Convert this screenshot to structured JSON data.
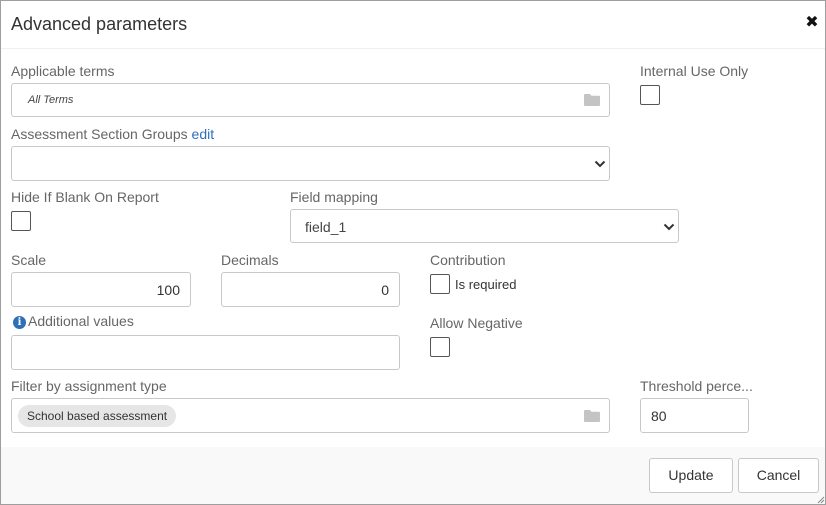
{
  "dialog": {
    "title": "Advanced parameters",
    "close_icon": "close-icon"
  },
  "applicable_terms": {
    "label": "Applicable terms",
    "value": "All Terms",
    "icon": "folder-icon"
  },
  "internal_use_only": {
    "label": "Internal Use Only",
    "checked": false
  },
  "assessment_section_groups": {
    "label": "Assessment Section Groups",
    "edit_label": "edit",
    "value": ""
  },
  "hide_if_blank": {
    "label": "Hide If Blank On Report",
    "checked": false
  },
  "field_mapping": {
    "label": "Field mapping",
    "value": "field_1"
  },
  "scale": {
    "label": "Scale",
    "value": "100"
  },
  "decimals": {
    "label": "Decimals",
    "value": "0"
  },
  "contribution": {
    "label": "Contribution",
    "checkbox_label": "Is required",
    "checked": false
  },
  "additional_values": {
    "label": "Additional values",
    "value": "",
    "icon": "info-icon"
  },
  "allow_negative": {
    "label": "Allow Negative",
    "checked": false
  },
  "filter_by_assignment_type": {
    "label": "Filter by assignment type",
    "chip": "School based assessment",
    "icon": "folder-icon"
  },
  "threshold": {
    "label": "Threshold perce...",
    "value": "80"
  },
  "footer": {
    "update_label": "Update",
    "cancel_label": "Cancel"
  },
  "colors": {
    "link": "#2f6fb8",
    "border": "#c8c8c8",
    "footer_bg": "#f9f9f9"
  }
}
